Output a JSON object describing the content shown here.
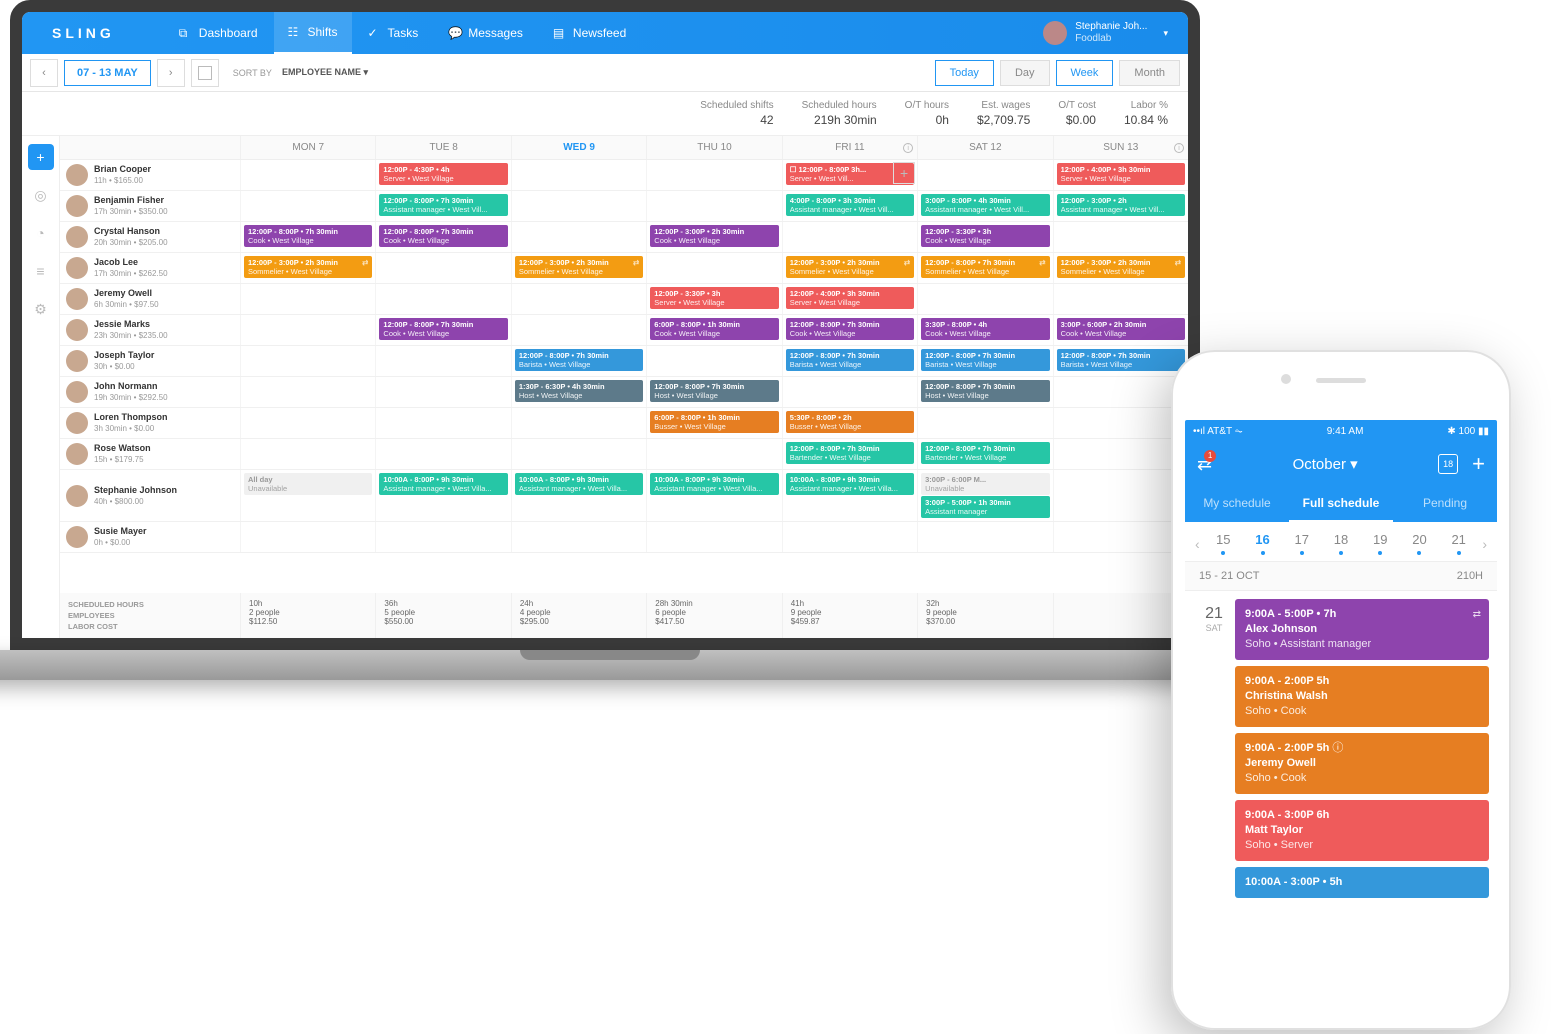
{
  "brand": "SLING",
  "nav": {
    "dashboard": "Dashboard",
    "shifts": "Shifts",
    "tasks": "Tasks",
    "messages": "Messages",
    "newsfeed": "Newsfeed"
  },
  "user": {
    "name": "Stephanie Joh...",
    "org": "Foodlab"
  },
  "toolbar": {
    "range": "07 - 13 MAY",
    "sort_by_label": "SORT BY",
    "sort_by_value": "EMPLOYEE NAME",
    "today": "Today",
    "day": "Day",
    "week": "Week",
    "month": "Month"
  },
  "stats": {
    "scheduled_shifts_l": "Scheduled shifts",
    "scheduled_shifts_v": "42",
    "scheduled_hours_l": "Scheduled hours",
    "scheduled_hours_v": "219h 30min",
    "ot_hours_l": "O/T hours",
    "ot_hours_v": "0h",
    "est_wages_l": "Est. wages",
    "est_wages_v": "$2,709.75",
    "ot_cost_l": "O/T cost",
    "ot_cost_v": "$0.00",
    "labor_pct_l": "Labor %",
    "labor_pct_v": "10.84 %"
  },
  "days": [
    "MON 7",
    "TUE 8",
    "WED 9",
    "THU 10",
    "FRI 11",
    "SAT 12",
    "SUN 13"
  ],
  "active_day_index": 2,
  "colors": {
    "red": "#ef5b5b",
    "teal": "#26c6a6",
    "purple": "#8e44ad",
    "orange": "#f39c12",
    "blue": "#3498db",
    "slate": "#5d7a8a",
    "amber": "#e67e22",
    "green": "#27ae60"
  },
  "employees": [
    {
      "name": "Brian Cooper",
      "sub": "11h • $165.00",
      "cells": [
        null,
        {
          "t": "12:00P - 4:30P • 4h",
          "r": "Server • West Village",
          "c": "red"
        },
        null,
        null,
        {
          "t": "12:00P - 8:00P 3h...",
          "r": "Server • West Vill...",
          "c": "red",
          "add": true,
          "chk": true
        },
        null,
        {
          "t": "12:00P - 4:00P • 3h 30min",
          "r": "Server • West Village",
          "c": "red"
        }
      ]
    },
    {
      "name": "Benjamin Fisher",
      "sub": "17h 30min • $350.00",
      "cells": [
        null,
        {
          "t": "12:00P - 8:00P • 7h 30min",
          "r": "Assistant manager • West Vill...",
          "c": "teal"
        },
        null,
        null,
        {
          "t": "4:00P - 8:00P • 3h 30min",
          "r": "Assistant manager • West Vill...",
          "c": "teal"
        },
        {
          "t": "3:00P - 8:00P • 4h 30min",
          "r": "Assistant manager • West Vill...",
          "c": "teal"
        },
        {
          "t": "12:00P - 3:00P • 2h",
          "r": "Assistant manager • West Vill...",
          "c": "teal"
        }
      ]
    },
    {
      "name": "Crystal Hanson",
      "sub": "20h 30min • $205.00",
      "cells": [
        {
          "t": "12:00P - 8:00P • 7h 30min",
          "r": "Cook • West Village",
          "c": "purple"
        },
        {
          "t": "12:00P - 8:00P • 7h 30min",
          "r": "Cook • West Village",
          "c": "purple"
        },
        null,
        {
          "t": "12:00P - 3:00P • 2h 30min",
          "r": "Cook • West Village",
          "c": "purple"
        },
        null,
        {
          "t": "12:00P - 3:30P • 3h",
          "r": "Cook • West Village",
          "c": "purple"
        },
        null
      ]
    },
    {
      "name": "Jacob Lee",
      "sub": "17h 30min • $262.50",
      "cells": [
        {
          "t": "12:00P - 3:00P • 2h 30min",
          "r": "Sommelier • West Village",
          "c": "orange",
          "sw": true
        },
        null,
        {
          "t": "12:00P - 3:00P • 2h 30min",
          "r": "Sommelier • West Village",
          "c": "orange",
          "sw": true
        },
        null,
        {
          "t": "12:00P - 3:00P • 2h 30min",
          "r": "Sommelier • West Village",
          "c": "orange",
          "sw": true
        },
        {
          "t": "12:00P - 8:00P • 7h 30min",
          "r": "Sommelier • West Village",
          "c": "orange",
          "sw": true
        },
        {
          "t": "12:00P - 3:00P • 2h 30min",
          "r": "Sommelier • West Village",
          "c": "orange",
          "sw": true
        }
      ]
    },
    {
      "name": "Jeremy Owell",
      "sub": "6h 30min • $97.50",
      "cells": [
        null,
        null,
        null,
        {
          "t": "12:00P - 3:30P • 3h",
          "r": "Server • West Village",
          "c": "red"
        },
        {
          "t": "12:00P - 4:00P • 3h 30min",
          "r": "Server • West Village",
          "c": "red"
        },
        null,
        null
      ]
    },
    {
      "name": "Jessie Marks",
      "sub": "23h 30min • $235.00",
      "cells": [
        null,
        {
          "t": "12:00P - 8:00P • 7h 30min",
          "r": "Cook • West Village",
          "c": "purple"
        },
        null,
        {
          "t": "6:00P - 8:00P • 1h 30min",
          "r": "Cook • West Village",
          "c": "purple"
        },
        {
          "t": "12:00P - 8:00P • 7h 30min",
          "r": "Cook • West Village",
          "c": "purple"
        },
        {
          "t": "3:30P - 8:00P • 4h",
          "r": "Cook • West Village",
          "c": "purple"
        },
        {
          "t": "3:00P - 6:00P • 2h 30min",
          "r": "Cook • West Village",
          "c": "purple"
        }
      ]
    },
    {
      "name": "Joseph Taylor",
      "sub": "30h • $0.00",
      "cells": [
        null,
        null,
        {
          "t": "12:00P - 8:00P • 7h 30min",
          "r": "Barista • West Village",
          "c": "blue"
        },
        null,
        {
          "t": "12:00P - 8:00P • 7h 30min",
          "r": "Barista • West Village",
          "c": "blue"
        },
        {
          "t": "12:00P - 8:00P • 7h 30min",
          "r": "Barista • West Village",
          "c": "blue"
        },
        {
          "t": "12:00P - 8:00P • 7h 30min",
          "r": "Barista • West Village",
          "c": "blue"
        }
      ]
    },
    {
      "name": "John Normann",
      "sub": "19h 30min • $292.50",
      "cells": [
        null,
        null,
        {
          "t": "1:30P - 6:30P • 4h 30min",
          "r": "Host • West Village",
          "c": "slate"
        },
        {
          "t": "12:00P - 8:00P • 7h 30min",
          "r": "Host • West Village",
          "c": "slate"
        },
        null,
        {
          "t": "12:00P - 8:00P • 7h 30min",
          "r": "Host • West Village",
          "c": "slate"
        },
        null
      ]
    },
    {
      "name": "Loren Thompson",
      "sub": "3h 30min • $0.00",
      "cells": [
        null,
        null,
        null,
        {
          "t": "6:00P - 8:00P • 1h 30min",
          "r": "Busser • West Village",
          "c": "amber"
        },
        {
          "t": "5:30P - 8:00P • 2h",
          "r": "Busser • West Village",
          "c": "amber"
        },
        null,
        null
      ]
    },
    {
      "name": "Rose Watson",
      "sub": "15h • $179.75",
      "cells": [
        null,
        null,
        null,
        null,
        {
          "t": "12:00P - 8:00P • 7h 30min",
          "r": "Bartender • West Village",
          "c": "teal"
        },
        {
          "t": "12:00P - 8:00P • 7h 30min",
          "r": "Bartender • West Village",
          "c": "teal"
        },
        null
      ]
    },
    {
      "name": "Stephanie Johnson",
      "sub": "40h • $800.00",
      "cells": [
        {
          "t": "All day",
          "r": "Unavailable",
          "c": "unavail"
        },
        {
          "t": "10:00A - 8:00P • 9h 30min",
          "r": "Assistant manager • West Villa...",
          "c": "teal"
        },
        {
          "t": "10:00A - 8:00P • 9h 30min",
          "r": "Assistant manager • West Villa...",
          "c": "teal"
        },
        {
          "t": "10:00A - 8:00P • 9h 30min",
          "r": "Assistant manager • West Villa...",
          "c": "teal"
        },
        {
          "t": "10:00A - 8:00P • 9h 30min",
          "r": "Assistant manager • West Villa...",
          "c": "teal"
        },
        {
          "t": "3:00P - 6:00P M...",
          "r": "Unavailable",
          "c": "unavail",
          "extra": {
            "t": "3:00P - 5:00P • 1h 30min",
            "r": "Assistant manager",
            "c": "teal"
          }
        },
        null
      ]
    },
    {
      "name": "Susie Mayer",
      "sub": "0h • $0.00",
      "cells": [
        null,
        null,
        null,
        null,
        null,
        null,
        null
      ]
    }
  ],
  "footer": {
    "labels": {
      "hours": "SCHEDULED HOURS",
      "employees": "EMPLOYEES",
      "cost": "LABOR COST"
    },
    "cols": [
      {
        "h": "10h",
        "e": "2 people",
        "c": "$112.50"
      },
      {
        "h": "36h",
        "e": "5 people",
        "c": "$550.00"
      },
      {
        "h": "24h",
        "e": "4 people",
        "c": "$295.00"
      },
      {
        "h": "28h 30min",
        "e": "6 people",
        "c": "$417.50"
      },
      {
        "h": "41h",
        "e": "9 people",
        "c": "$459.87"
      },
      {
        "h": "32h",
        "e": "9 people",
        "c": "$370.00"
      },
      {
        "h": "",
        "e": "",
        "c": ""
      }
    ]
  },
  "phone": {
    "carrier": "AT&T",
    "time": "9:41 AM",
    "battery": "100",
    "title": "October",
    "cal_day": "18",
    "badge": "1",
    "tabs": {
      "my": "My schedule",
      "full": "Full schedule",
      "pending": "Pending"
    },
    "dates": [
      "15",
      "16",
      "17",
      "18",
      "19",
      "20",
      "21"
    ],
    "active_date_index": 1,
    "range_l": "15 - 21 OCT",
    "range_r": "210H",
    "day_num": "21",
    "day_wk": "SAT",
    "shifts": [
      {
        "t": "9:00A - 5:00P • 7h",
        "n": "Alex Johnson",
        "r": "Soho • Assistant manager",
        "c": "purple",
        "sw": true
      },
      {
        "t": "9:00A - 2:00P 5h",
        "n": "Christina Walsh",
        "r": "Soho • Cook",
        "c": "amber"
      },
      {
        "t": "9:00A - 2:00P 5h",
        "n": "Jeremy Owell",
        "r": "Soho • Cook",
        "c": "amber",
        "info": true
      },
      {
        "t": "9:00A - 3:00P 6h",
        "n": "Matt Taylor",
        "r": "Soho • Server",
        "c": "red"
      },
      {
        "t": "10:00A - 3:00P • 5h",
        "n": "",
        "r": "",
        "c": "blue"
      }
    ]
  }
}
